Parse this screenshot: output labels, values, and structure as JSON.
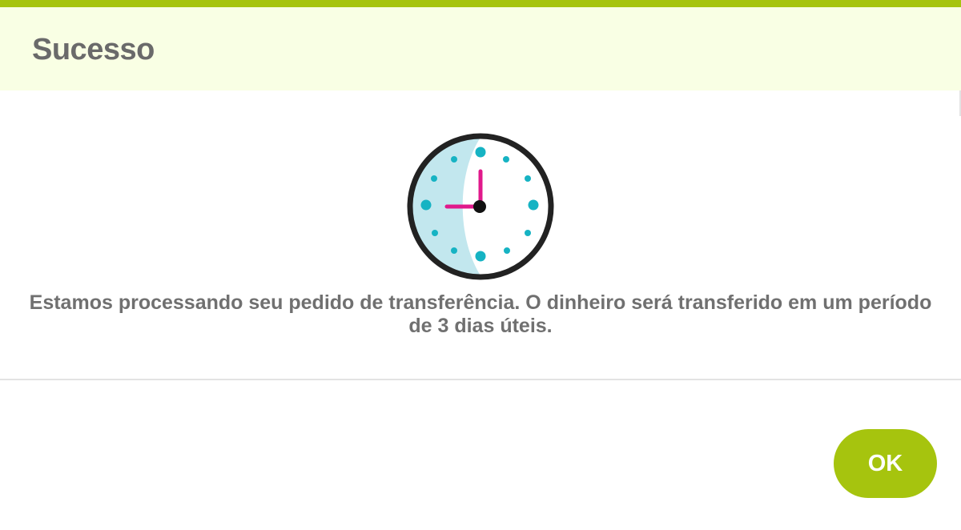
{
  "dialog": {
    "title": "Sucesso",
    "icon": "clock-icon",
    "message": "Estamos processando seu pedido de transferência. O dinheiro será transferido em um período de 3 dias úteis.",
    "ok_label": "OK"
  },
  "colors": {
    "accent": "#a6c40e",
    "header_background": "#f9ffe4",
    "title_text": "#6a6a6a",
    "body_text": "#707070",
    "clock_face_shade": "#c2e7ee",
    "clock_dots": "#16b3c3",
    "clock_hands": "#e0198b",
    "clock_outline": "#222222"
  }
}
